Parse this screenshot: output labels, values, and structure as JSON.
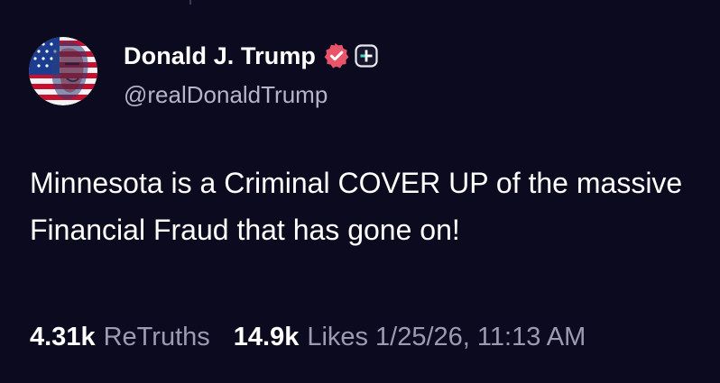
{
  "post": {
    "author": {
      "display_name": "Donald J. Trump",
      "handle": "@realDonaldTrump",
      "verified": true,
      "avatar_icon": "flag-portrait-avatar"
    },
    "text": "Minnesota is a Criminal COVER UP of the massive Financial Fraud that has gone on!",
    "stats": {
      "retruths_count": "4.31k",
      "retruths_label": "ReTruths",
      "likes_count": "14.9k",
      "likes_label": "Likes",
      "timestamp": "1/25/26, 11:13 AM"
    }
  },
  "colors": {
    "background": "#0b0a1e",
    "primary_text": "#ffffff",
    "secondary_text": "#b6b5c7",
    "stat_label": "#9d9bb4",
    "verified_badge": "#e9546b"
  },
  "icons": {
    "verified": "verified-badge-icon",
    "plus": "plus-badge-icon"
  }
}
